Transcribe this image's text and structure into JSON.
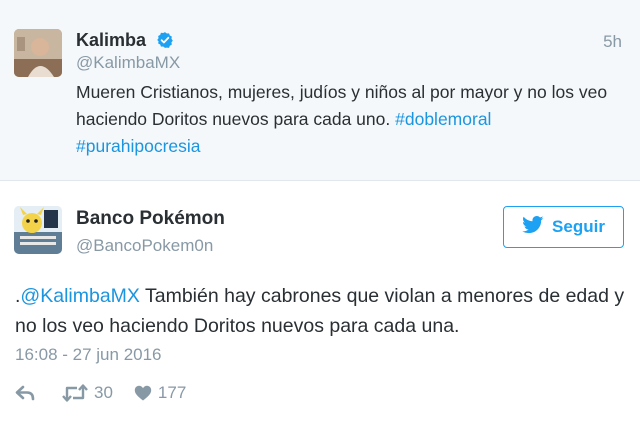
{
  "parent": {
    "name": "Kalimba",
    "handle": "@KalimbaMX",
    "time": "5h",
    "text_main": "Mueren Cristianos, mujeres, judíos y niños al por mayor y no los veo haciendo Doritos nuevos para cada uno.",
    "hashtag1": "#doblemoral",
    "hashtag2": "#purahipocresia"
  },
  "main": {
    "name": "Banco Pokémon",
    "handle": "@BancoPokem0n",
    "follow_label": "Seguir",
    "text_prefix": ".",
    "mention": "@KalimbaMX",
    "text_rest": " También hay cabrones que violan a menores de edad y no los veo haciendo Doritos nuevos para cada una.",
    "date": "16:08 - 27 jun 2016",
    "retweets": "30",
    "likes": "177"
  },
  "colors": {
    "link": "#1b95e0",
    "muted": "#8899a6",
    "text": "#292f33",
    "brand": "#1da1f2",
    "verified": "#1da1f2"
  },
  "icons": [
    "verified-icon",
    "twitter-bird-icon",
    "reply-icon",
    "retweet-icon",
    "like-icon"
  ]
}
